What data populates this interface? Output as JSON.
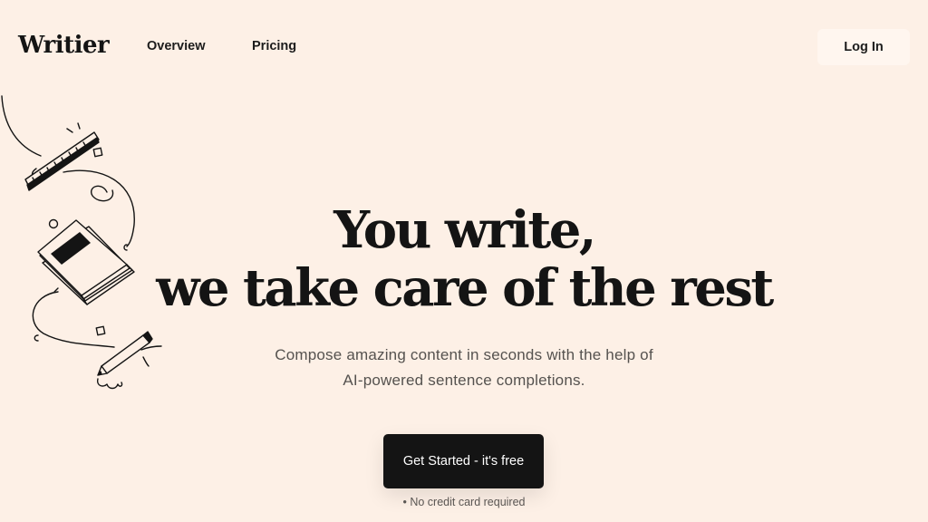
{
  "brand": {
    "name": "Writier"
  },
  "nav": {
    "links": [
      {
        "label": "Overview"
      },
      {
        "label": "Pricing"
      }
    ],
    "login_label": "Log In"
  },
  "hero": {
    "title_line1": "You write,",
    "title_line2": "we take care of the rest",
    "subtitle_line1": "Compose amazing content in seconds with the help of",
    "subtitle_line2": "AI-powered sentence completions.",
    "cta_label": "Get Started - it's free",
    "cta_note": "• No credit card required"
  },
  "illustration": {
    "icons": [
      "ruler-icon",
      "notebook-icon",
      "pencil-icon"
    ]
  },
  "colors": {
    "background": "#fdf0e6",
    "text": "#141414",
    "cta_background": "#141414",
    "cta_text": "#ffffff",
    "login_background": "#fff6ef",
    "subtitle": "#55524f"
  }
}
